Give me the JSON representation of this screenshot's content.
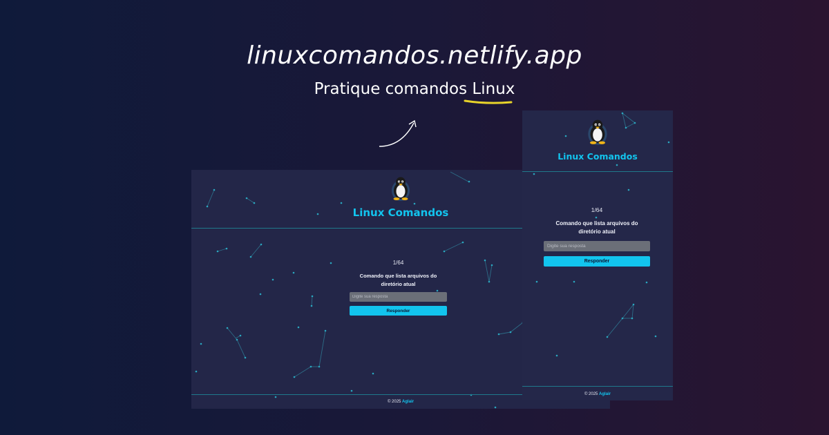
{
  "hero": {
    "site_url": "linuxcomandos.netlify.app",
    "tagline_prefix": "Pratique comandos ",
    "tagline_highlight": "Linux"
  },
  "colors": {
    "accent": "#12c4ee",
    "highlight_underline": "#e8d42a",
    "panel": "#232648"
  },
  "app": {
    "title": "Linux Comandos",
    "counter": "1/64",
    "question": "Comando que lista arquivos do diretório atual",
    "input_placeholder": "Digite sua resposta",
    "submit_label": "Responder",
    "footer_prefix": "© 2025 ",
    "footer_author": "Aglair"
  },
  "icons": {
    "logo": "tux-penguin-icon",
    "arrow": "curved-arrow-icon"
  }
}
